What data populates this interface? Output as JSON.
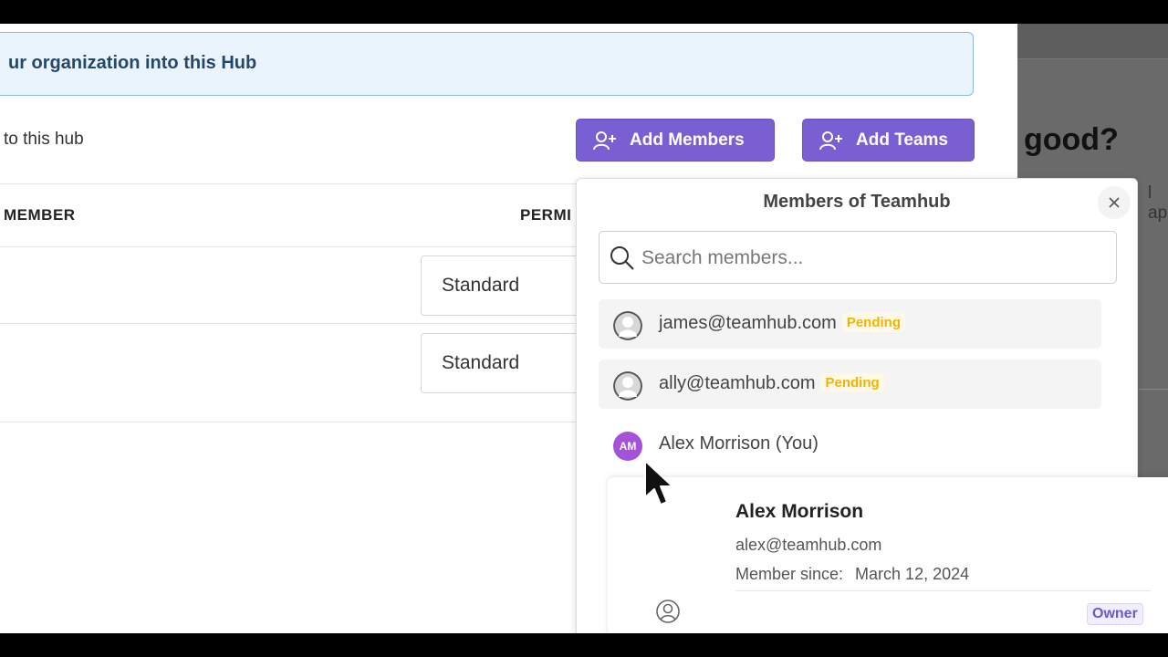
{
  "banner": {
    "text": "ur organization into this Hub"
  },
  "subtext": "to this hub",
  "buttons": {
    "add_members": "Add Members",
    "add_teams": "Add Teams"
  },
  "table": {
    "headers": {
      "member": "MEMBER",
      "permission": "PERMI"
    },
    "rows": [
      {
        "permission": "Standard"
      },
      {
        "permission": "Standard"
      }
    ]
  },
  "background_dialog": {
    "title_fragment": "good?",
    "text_fragment": "l ap"
  },
  "panel": {
    "title": "Members of Teamhub",
    "search_placeholder": "Search members...",
    "members": [
      {
        "email": "james@teamhub.com",
        "status": "Pending",
        "avatar": "default-avatar-icon"
      },
      {
        "email": "ally@teamhub.com",
        "status": "Pending",
        "avatar": "default-avatar-icon"
      },
      {
        "name": "Alex Morrison (You)",
        "initials": "AM",
        "avatar_color": "#a352d9"
      }
    ]
  },
  "profile_card": {
    "name": "Alex Morrison",
    "email": "alex@teamhub.com",
    "member_since_label": "Member since:",
    "member_since_value": "March 12, 2024",
    "role": "Owner"
  },
  "colors": {
    "primary": "#7a5fd2",
    "banner_bg": "#eaf4fc",
    "banner_text": "#25476b",
    "pending": "#f0b400",
    "avatar_initials": "#a352d9"
  }
}
